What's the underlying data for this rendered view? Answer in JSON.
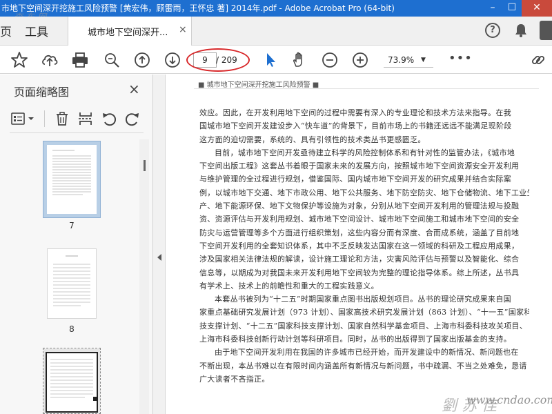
{
  "window": {
    "title": "市地下空间深开挖施工风险预警 [黄宏伟，顾雷雨，王怀忠 著] 2014年.pdf - Adobe Acrobat Pro (64-bit)"
  },
  "tabbar": {
    "home_label": "页",
    "tools_label": "工具",
    "doc_tab_label": "城市地下空间深开...",
    "doc_tab_close": "×"
  },
  "toolbar": {
    "current_page": "9",
    "total_pages": "/ 209",
    "zoom": "73.9%",
    "more": "•••"
  },
  "leftpanel": {
    "title": "页面缩略图",
    "close": "×",
    "thumbnails": [
      {
        "label": "7",
        "selected": true
      },
      {
        "label": "8",
        "selected": false
      }
    ]
  },
  "document": {
    "header": "■ 城市地下空间深开挖施工风险预警 ■",
    "lines": [
      {
        "text": "效应。因此，在开发利用地下空间的过程中需要有深入的专业理论和技术方法来指导。在我",
        "indent": false
      },
      {
        "text": "国城市地下空间开发建设步入“快车道”的背景下，目前市场上的书籍还远远不能满足现阶段",
        "indent": false
      },
      {
        "text": "这方面的迫切需要，系统的、具有引领性的技术类丛书更感匮乏。",
        "indent": false
      },
      {
        "text": "目前，城市地下空间开发亟待建立科学的风险控制体系和有针对性的监管办法，《城市地",
        "indent": true
      },
      {
        "text": "下空间出版工程》这套丛书着眼于国家未来的发展方向，按照城市地下空间资源安全开发利用",
        "indent": false
      },
      {
        "text": "与维护管理的全过程进行规划，借鉴国际、国内城市地下空间开发的研究成果并结合实际案",
        "indent": false
      },
      {
        "text": "例，以城市地下交通、地下市政公用、地下公共服务、地下防空防灾、地下仓储物流、地下工业生",
        "indent": false
      },
      {
        "text": "产、地下能源环保、地下文物保护等设施为对象，分别从地下空间开发利用的管理法规与投融",
        "indent": false
      },
      {
        "text": "资、资源评估与开发利用规划、城市地下空间设计、城市地下空间施工和城市地下空间的安全",
        "indent": false
      },
      {
        "text": "防灾与运营管理等多个方面进行组织策划，这些内容分而有深度、合而成系统，涵盖了目前地",
        "indent": false
      },
      {
        "text": "下空间开发利用的全套知识体系，其中不乏反映发达国家在这一领域的科研及工程应用成果，",
        "indent": false
      },
      {
        "text": "涉及国家相关法律法规的解读，设计施工理论和方法，灾害风险评估与预警以及智能化、综合",
        "indent": false
      },
      {
        "text": "信息等，以期成为对我国未来开发利用地下空间较为完整的理论指导体系。综上所述，丛书具",
        "indent": false
      },
      {
        "text": "有学术上、技术上的前瞻性和重大的工程实践意义。",
        "indent": false
      },
      {
        "text": "本套丛书被列为“十二五”时期国家重点图书出版规划项目。丛书的理论研究成果来自国",
        "indent": true
      },
      {
        "text": "家重点基础研究发展计划（973 计划）、国家高技术研究发展计划（863 计划）、“十一五”国家科",
        "indent": false
      },
      {
        "text": "技支撑计划、“十二五”国家科技支撑计划、国家自然科学基金项目、上海市科委科技攻关项目、",
        "indent": false
      },
      {
        "text": "上海市科委科技创新行动计划等科研项目。同时，丛书的出版得到了国家出版基金的支持。",
        "indent": false
      },
      {
        "text": "由于地下空间开发利用在我国的许多城市已经开始，而开发建设中的新情况、新问题也在",
        "indent": true
      },
      {
        "text": "不断出现，本丛书难以在有限时间内涵盖所有新情况与新问题，书中疏漏、不当之处难免，恳请",
        "indent": false
      },
      {
        "text": "广大读者不吝指正。",
        "indent": false
      }
    ]
  },
  "watermark": {
    "top": "查 东 网",
    "bottom": "www.cndao.com",
    "sign": "劉 苏 佳"
  }
}
